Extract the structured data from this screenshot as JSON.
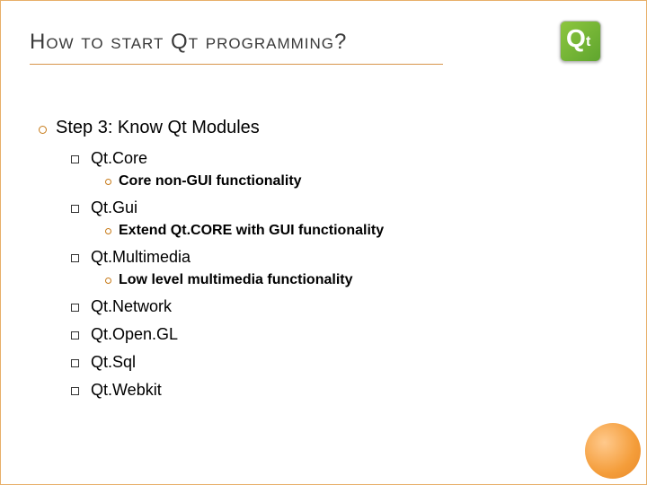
{
  "title": "How to start Qt programming?",
  "logo": {
    "letter1": "Q",
    "letter2": "t"
  },
  "step": {
    "heading": "Step 3: Know Qt Modules",
    "modules": [
      {
        "name": "Qt.Core",
        "desc": "Core non-GUI functionality"
      },
      {
        "name": "Qt.Gui",
        "desc": "Extend Qt.CORE with GUI functionality"
      },
      {
        "name": "Qt.Multimedia",
        "desc": "Low level multimedia functionality"
      },
      {
        "name": "Qt.Network",
        "desc": null
      },
      {
        "name": "Qt.Open.GL",
        "desc": null
      },
      {
        "name": "Qt.Sql",
        "desc": null
      },
      {
        "name": "Qt.Webkit",
        "desc": null
      }
    ]
  }
}
